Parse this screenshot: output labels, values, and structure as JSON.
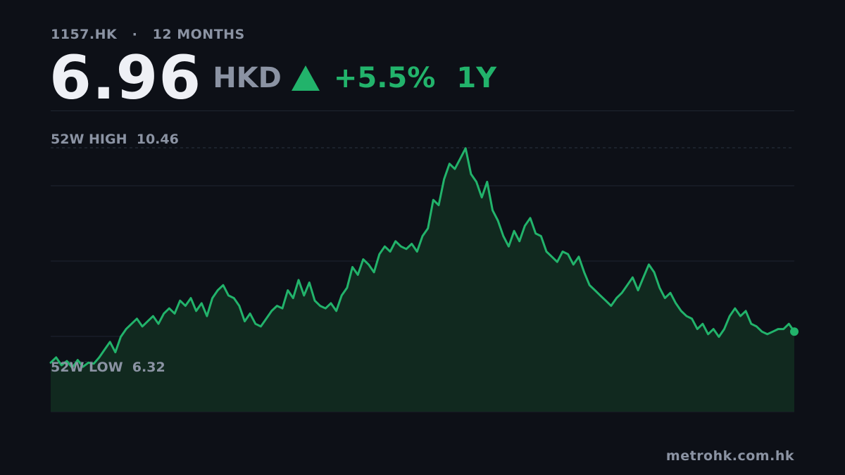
{
  "header": {
    "ticker": "1157.HK",
    "separator": "·",
    "range_label": "12 MONTHS",
    "price": "6.96",
    "currency": "HKD",
    "trend_icon": "up-triangle-icon",
    "change": "+5.5%",
    "period": "1Y"
  },
  "colors": {
    "background": "#0d1017",
    "accent": "#22b36b",
    "muted": "#8b93a3",
    "primary_text": "#eef0f5"
  },
  "footer": {
    "source": "metrohk.com.hk"
  },
  "chart_data": {
    "type": "area",
    "high_label": "52W HIGH",
    "high_value": "10.46",
    "low_label": "52W LOW",
    "low_value": "6.32",
    "ylim": [
      5.35,
      10.46
    ],
    "grid": true,
    "y": [
      6.3,
      6.4,
      6.25,
      6.33,
      6.2,
      6.35,
      6.22,
      6.3,
      6.28,
      6.4,
      6.55,
      6.7,
      6.5,
      6.8,
      6.95,
      7.05,
      7.15,
      7.0,
      7.1,
      7.2,
      7.05,
      7.25,
      7.35,
      7.25,
      7.5,
      7.4,
      7.55,
      7.3,
      7.45,
      7.2,
      7.55,
      7.7,
      7.8,
      7.6,
      7.55,
      7.4,
      7.1,
      7.25,
      7.05,
      7.0,
      7.15,
      7.3,
      7.4,
      7.35,
      7.7,
      7.55,
      7.9,
      7.6,
      7.85,
      7.5,
      7.4,
      7.35,
      7.45,
      7.3,
      7.6,
      7.75,
      8.15,
      8.0,
      8.3,
      8.2,
      8.05,
      8.4,
      8.55,
      8.45,
      8.65,
      8.55,
      8.5,
      8.6,
      8.45,
      8.75,
      8.9,
      9.45,
      9.35,
      9.85,
      10.15,
      10.05,
      10.25,
      10.45,
      9.95,
      9.8,
      9.5,
      9.8,
      9.25,
      9.05,
      8.75,
      8.55,
      8.85,
      8.65,
      8.95,
      9.1,
      8.8,
      8.75,
      8.45,
      8.35,
      8.25,
      8.45,
      8.4,
      8.2,
      8.35,
      8.05,
      7.8,
      7.7,
      7.6,
      7.5,
      7.4,
      7.55,
      7.65,
      7.8,
      7.95,
      7.7,
      7.95,
      8.2,
      8.05,
      7.75,
      7.55,
      7.65,
      7.45,
      7.3,
      7.2,
      7.15,
      6.95,
      7.05,
      6.85,
      6.95,
      6.8,
      6.95,
      7.2,
      7.35,
      7.2,
      7.3,
      7.05,
      7.0,
      6.9,
      6.85,
      6.9,
      6.95,
      6.95,
      7.05,
      6.9
    ]
  }
}
